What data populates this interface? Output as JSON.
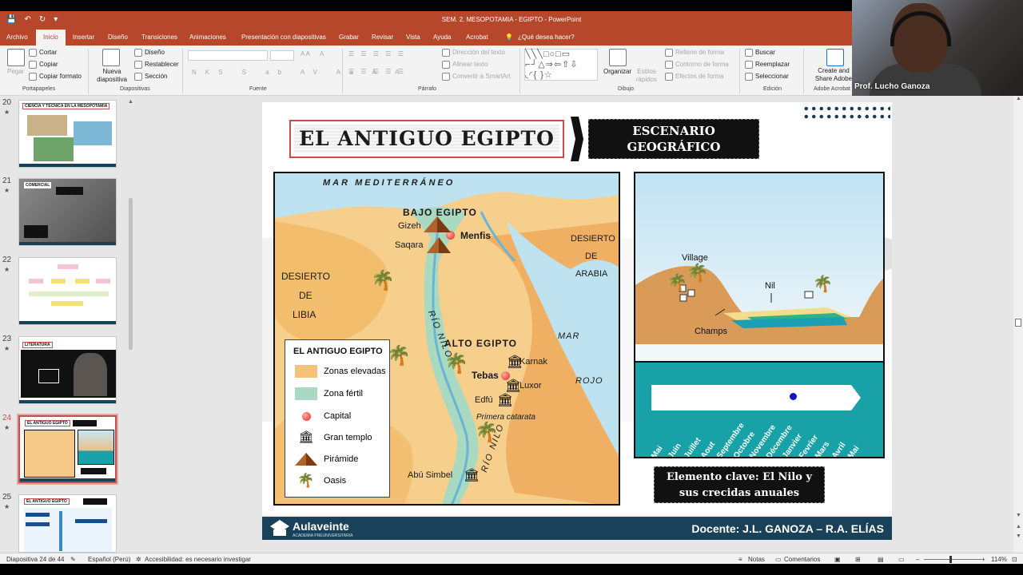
{
  "window": {
    "title": "SEM. 2. MESOPOTAMIA - EGIPTO  -  PowerPoint"
  },
  "quick_access": {
    "save_icon": "save-icon",
    "undo_icon": "undo-icon",
    "redo_icon": "redo-icon"
  },
  "tabs": [
    "Archivo",
    "Inicio",
    "Insertar",
    "Diseño",
    "Transiciones",
    "Animaciones",
    "Presentación con diapositivas",
    "Grabar",
    "Revisar",
    "Vista",
    "Ayuda",
    "Acrobat",
    "¿Qué desea hacer?"
  ],
  "ribbon": {
    "portapapeles": {
      "pegar": "Pegar",
      "cortar": "Cortar",
      "copiar": "Copiar",
      "copiar_formato": "Copiar formato",
      "group": "Portapapeles"
    },
    "diapositivas": {
      "nueva": "Nueva diapositiva",
      "diseno": "Diseño",
      "restablecer": "Restablecer",
      "seccion": "Sección",
      "group": "Diapositivas"
    },
    "fuente": {
      "group": "Fuente",
      "buttons": [
        "N",
        "K",
        "S",
        "S",
        "ab",
        "AV",
        "Aa",
        "A",
        "A"
      ]
    },
    "parrafo": {
      "group": "Párrafo",
      "direccion": "Dirección del texto",
      "alinear": "Alinear texto",
      "smartart": "Convertir a SmartArt"
    },
    "dibujo": {
      "group": "Dibujo",
      "organizar": "Organizar",
      "estilos": "Estilos rápidos",
      "relleno": "Relleno de forma",
      "contorno": "Contorno de forma",
      "efectos": "Efectos de forma"
    },
    "edicion": {
      "group": "Edición",
      "buscar": "Buscar",
      "reemplazar": "Reemplazar",
      "seleccionar": "Seleccionar"
    },
    "adobe": {
      "group": "Adobe Acrobat",
      "create": "Create and Share Adobe PDF"
    }
  },
  "webcam": {
    "name": "Prof. Lucho Ganoza"
  },
  "thumbnails": [
    {
      "num": "20",
      "title": "CIENCIA Y TÉCNICA EN LA MESOPOTAMIA"
    },
    {
      "num": "21",
      "title": "COMERCIAL"
    },
    {
      "num": "22",
      "title": ""
    },
    {
      "num": "23",
      "title": "LITERATURA"
    },
    {
      "num": "24",
      "title": "EL ANTIGUO EGIPTO",
      "selected": true
    },
    {
      "num": "25",
      "title": "EL ANTIGUO EGIPTO"
    }
  ],
  "slide": {
    "title": "EL ANTIGUO EGIPTO",
    "subtitle": "ESCENARIO GEOGRÁFICO",
    "map": {
      "sea_north": "MAR MEDITERRÁNEO",
      "bajo": "BAJO EGIPTO",
      "alto": "ALTO EGIPTO",
      "gizeh": "Gizeh",
      "saqara": "Saqara",
      "menfis": "Menfis",
      "desierto_libia": [
        "DESIERTO",
        "DE",
        "LIBIA"
      ],
      "desierto_arabia": [
        "DESIERTO",
        "DE",
        "ARABIA"
      ],
      "rio_nilo": "RÍO NILO",
      "rio_nilo2": "RÍO NILO",
      "mar": "MAR",
      "rojo": "ROJO",
      "karnak": "Karnak",
      "tebas": "Tebas",
      "luxor": "Luxor",
      "edfu": "Edfú",
      "catarata": "Primera catarata",
      "abu_simbel": "Abú Simbel",
      "legend": {
        "title": "EL ANTIGUO EGIPTO",
        "items": [
          "Zonas elevadas",
          "Zona fértil",
          "Capital",
          "Gran templo",
          "Pirámide",
          "Oasis"
        ]
      }
    },
    "diagram": {
      "village": "Village",
      "nil": "Nil",
      "champs": "Champs",
      "months": [
        "Mai",
        "Juin",
        "Juillet",
        "Aout",
        "Septembre",
        "Octobre",
        "Novembre",
        "Décembre",
        "Janvier",
        "Fevrier",
        "Mars",
        "Avril",
        "Mai"
      ]
    },
    "caption": [
      "Elemento clave: El Nilo y",
      "sus crecidas anuales"
    ],
    "footer": {
      "brand": "Aulaveinte",
      "brand_sub": "ACADEMIA PREUNIVERSITARIA",
      "docente": "Docente: J.L. GANOZA – R.A. ELÍAS"
    }
  },
  "status": {
    "slide_info": "Diapositiva 24 de 44",
    "language": "Español (Perú)",
    "accessibility": "Accesibilidad: es necesario investigar",
    "notas": "Notas",
    "comentarios": "Comentarios",
    "zoom": "114%"
  }
}
